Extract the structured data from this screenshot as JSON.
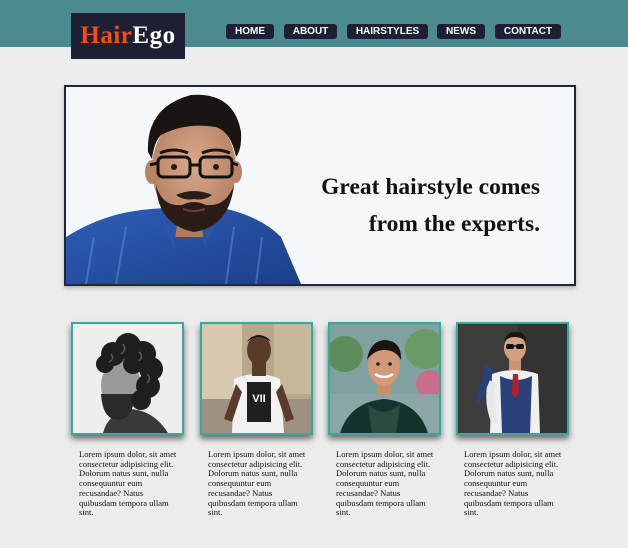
{
  "brand": {
    "part1": "Hair",
    "part2": "Ego",
    "accent_color": "#f24d1c",
    "bg_color": "#1d2033"
  },
  "nav": {
    "items": [
      "HOME",
      "ABOUT",
      "HAIRSTYLES",
      "NEWS",
      "CONTACT"
    ]
  },
  "hero": {
    "line1": "Great hairstyle comes",
    "line2": "from the experts."
  },
  "cards": [
    {
      "text": "Lorem ipsum dolor, sit amet consectetur adipisicing elit. Dolorum natus sunt, nulla consequuntur eum recusandae? Natus quibusdam tempora ullam sint."
    },
    {
      "text": "Lorem ipsum dolor, sit amet consectetur adipisicing elit. Dolorum natus sunt, nulla consequuntur eum recusandae? Natus quibusdam tempora ullam sint."
    },
    {
      "text": "Lorem ipsum dolor, sit amet consectetur adipisicing elit. Dolorum natus sunt, nulla consequuntur eum recusandae? Natus quibusdam tempora ullam sint."
    },
    {
      "text": "Lorem ipsum dolor, sit amet consectetur adipisicing elit. Dolorum natus sunt, nulla consequuntur eum recusandae? Natus quibusdam tempora ullam sint."
    }
  ],
  "colors": {
    "header": "#4b8a8e",
    "page_bg": "#ececec",
    "card_border": "#3aa89a"
  }
}
